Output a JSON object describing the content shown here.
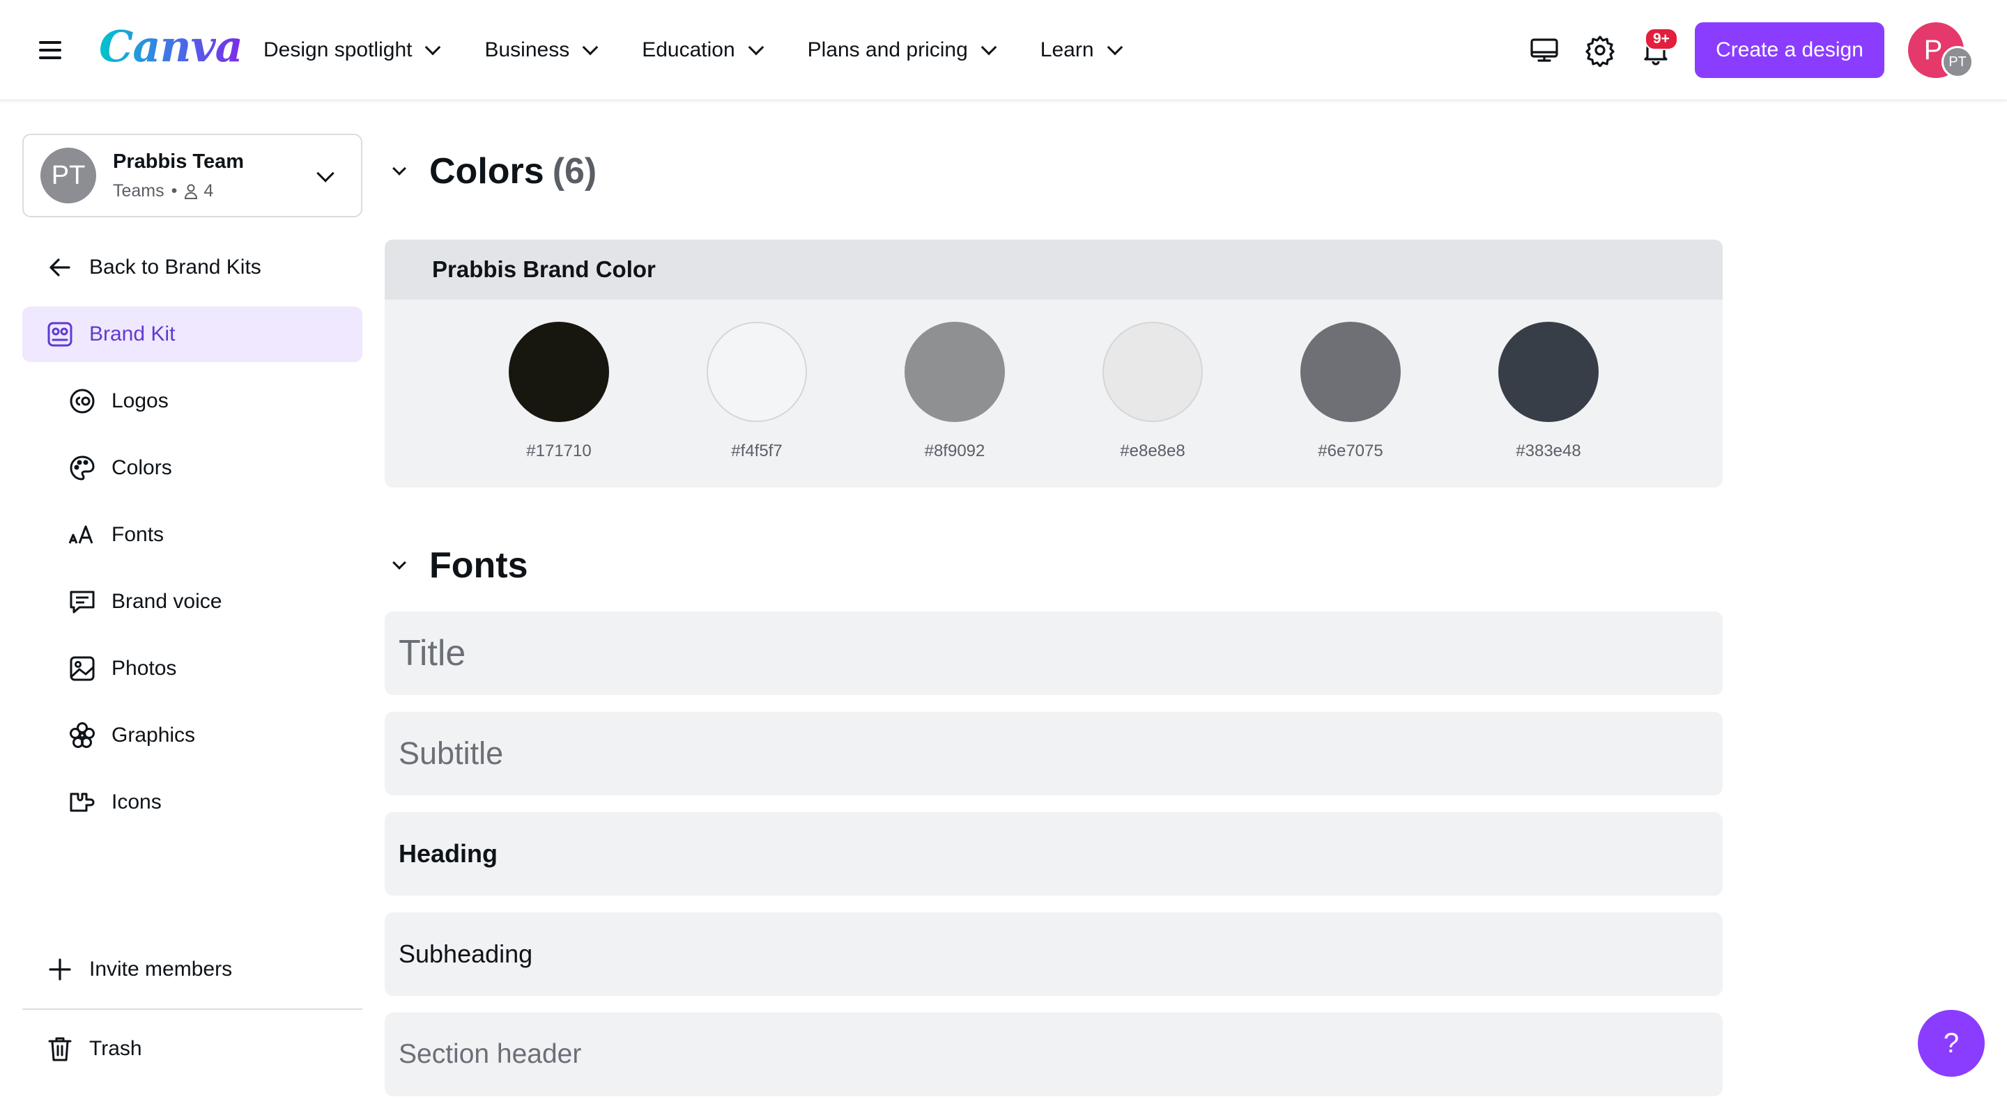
{
  "header": {
    "logo": "Canva",
    "nav": [
      {
        "label": "Design spotlight"
      },
      {
        "label": "Business"
      },
      {
        "label": "Education"
      },
      {
        "label": "Plans and pricing"
      },
      {
        "label": "Learn"
      }
    ],
    "notifications_badge": "9+",
    "create_button": "Create a design",
    "avatar_initial": "P",
    "avatar_team_initials": "PT"
  },
  "sidebar": {
    "team": {
      "initials": "PT",
      "name": "Prabbis Team",
      "type": "Teams",
      "dot": "•",
      "members": "4"
    },
    "back_label": "Back to Brand Kits",
    "active_label": "Brand Kit",
    "items": [
      {
        "label": "Logos",
        "icon": "logos-icon"
      },
      {
        "label": "Colors",
        "icon": "palette-icon"
      },
      {
        "label": "Fonts",
        "icon": "fonts-icon"
      },
      {
        "label": "Brand voice",
        "icon": "brand-voice-icon"
      },
      {
        "label": "Photos",
        "icon": "photos-icon"
      },
      {
        "label": "Graphics",
        "icon": "graphics-icon"
      },
      {
        "label": "Icons",
        "icon": "icons-icon"
      }
    ],
    "invite_label": "Invite members",
    "trash_label": "Trash"
  },
  "colors_section": {
    "title": "Colors",
    "count": "(6)",
    "palette_name": "Prabbis Brand Color",
    "swatches": [
      {
        "hex": "#171710"
      },
      {
        "hex": "#f4f5f7"
      },
      {
        "hex": "#8f9092"
      },
      {
        "hex": "#e8e8e8"
      },
      {
        "hex": "#6e7075"
      },
      {
        "hex": "#383e48"
      }
    ]
  },
  "fonts_section": {
    "title": "Fonts",
    "rows": [
      {
        "label": "Title"
      },
      {
        "label": "Subtitle"
      },
      {
        "label": "Heading"
      },
      {
        "label": "Subheading"
      },
      {
        "label": "Section header"
      }
    ]
  },
  "help_label": "?",
  "colors": {
    "accent": "#8b3dff",
    "active_bg": "#f0e8ff",
    "active_text": "#5f3bd1",
    "badge": "#e0203c"
  }
}
